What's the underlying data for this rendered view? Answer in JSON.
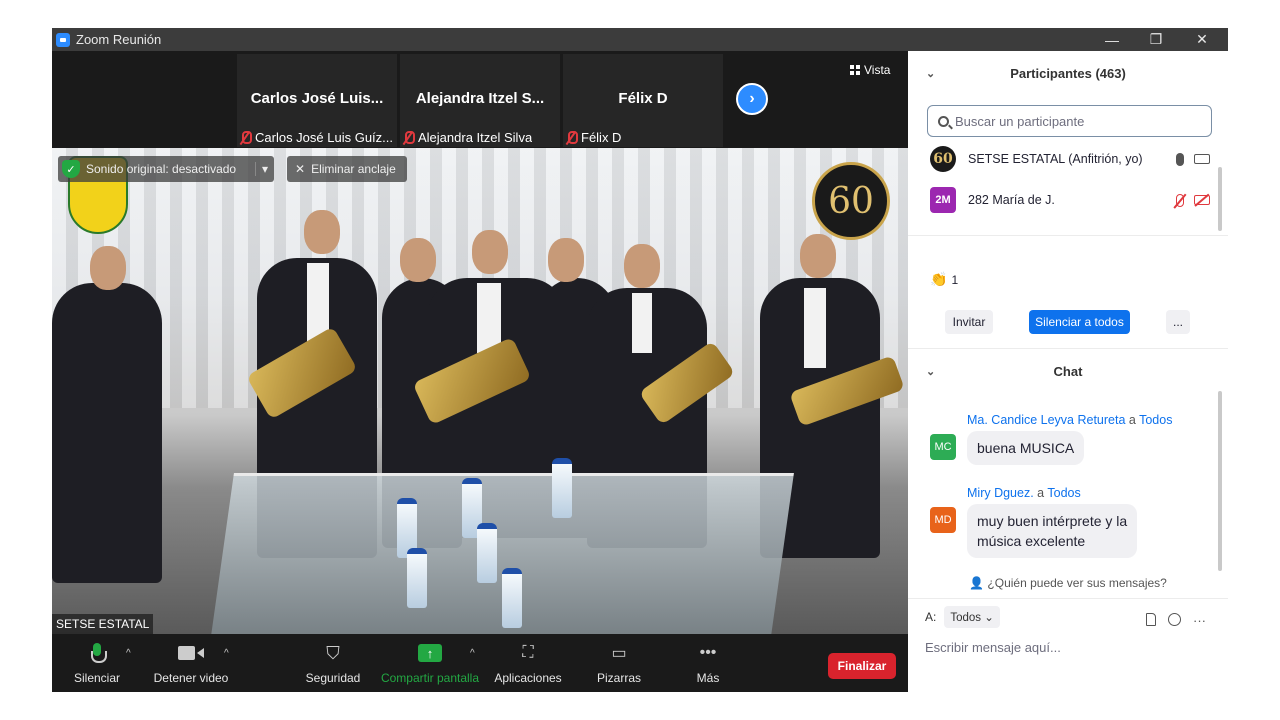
{
  "window": {
    "title": "Zoom Reunión",
    "controls": [
      "—",
      "❐",
      "✕"
    ]
  },
  "gallery": {
    "view_label": "Vista",
    "thumbs": [
      {
        "display": "Carlos José Luis...",
        "label": "Carlos José Luis Guíz..."
      },
      {
        "display": "Alejandra  Itzel S...",
        "label": "Alejandra Itzel Silva"
      },
      {
        "display": "Félix D",
        "label": "Félix D"
      }
    ]
  },
  "main_video": {
    "original_sound": "Sonido original: desactivado",
    "unpin": "Eliminar anclaje",
    "speaker_name": "SETSE ESTATAL",
    "logo_text": "60"
  },
  "toolbar": {
    "mute": "Silenciar",
    "stop_video": "Detener video",
    "security": "Seguridad",
    "share": "Compartir pantalla",
    "apps": "Aplicaciones",
    "whiteboards": "Pizarras",
    "more": "Más",
    "end": "Finalizar"
  },
  "participants": {
    "header": "Participantes (463)",
    "search_placeholder": "Buscar un participante",
    "list": [
      {
        "avatar": "60",
        "name": "SETSE ESTATAL (Anfitrión, yo)"
      },
      {
        "avatar": "2M",
        "name": "282 María de J."
      }
    ],
    "reaction_count": "1",
    "invite": "Invitar",
    "mute_all": "Silenciar a todos",
    "more": "..."
  },
  "chat": {
    "header": "Chat",
    "messages": [
      {
        "initials": "MC",
        "sender": "Ma. Candice Leyva Retureta",
        "to_word": "a",
        "to": "Todos",
        "text": "buena MUSICA",
        "color": "#2dac55"
      },
      {
        "initials": "MD",
        "sender": "Miry Dguez.",
        "to_word": "a",
        "to": "Todos",
        "text_line1": "muy buen intérprete y la",
        "text_line2": "música excelente",
        "color": "#e8631a"
      }
    ],
    "who_sees": "¿Quién puede ver sus mensajes?",
    "to_label": "A:",
    "to_value": "Todos",
    "input_placeholder": "Escribir mensaje aquí...",
    "more_tools": "···"
  },
  "colors": {
    "accent": "#0e72ed",
    "end_red": "#d9232d",
    "green": "#23a843"
  }
}
